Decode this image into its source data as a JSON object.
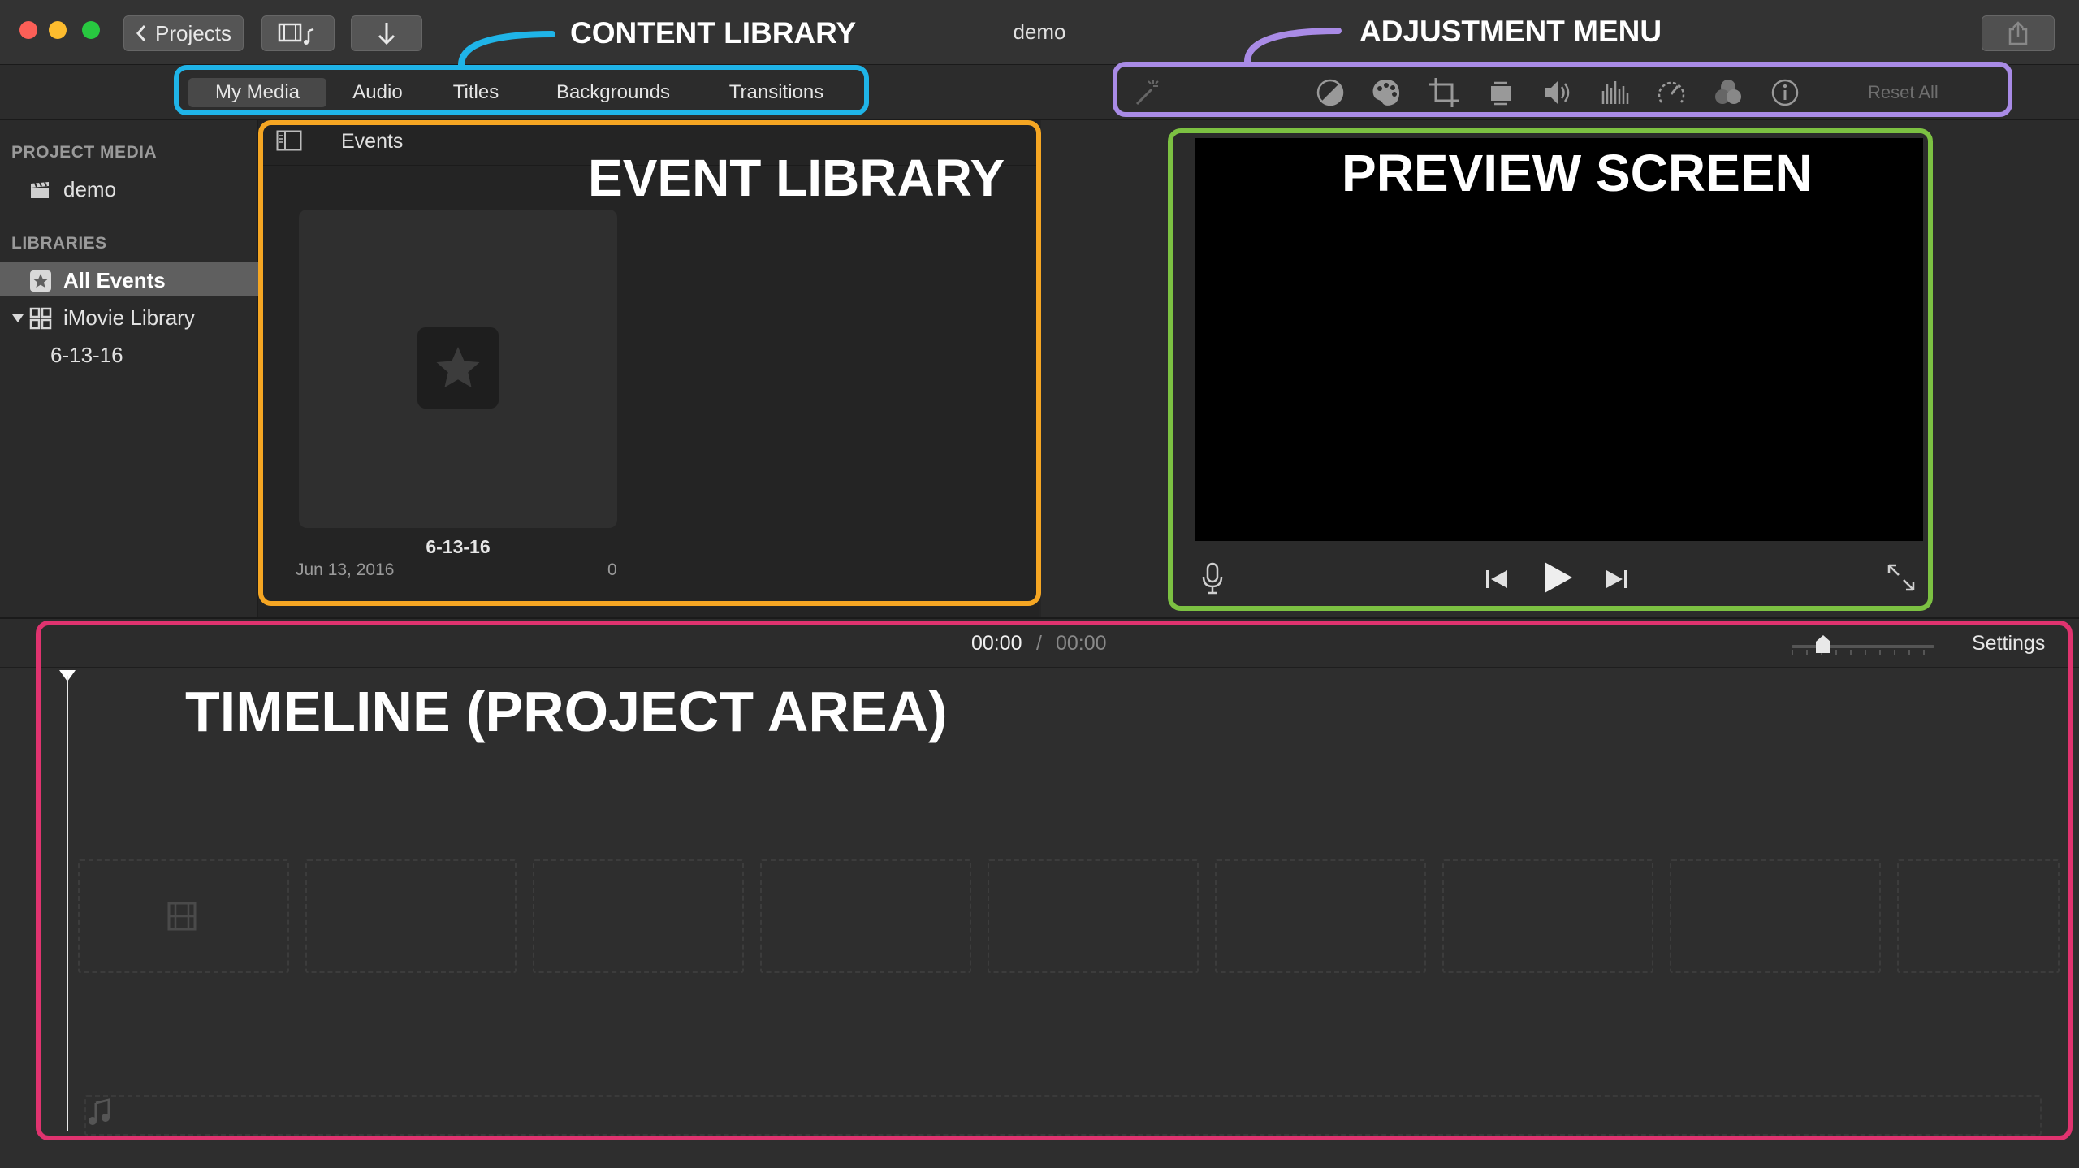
{
  "window": {
    "title": "demo"
  },
  "toolbar": {
    "projects_label": "Projects",
    "share_icon": "share-icon"
  },
  "tabs": [
    "My Media",
    "Audio",
    "Titles",
    "Backgrounds",
    "Transitions"
  ],
  "active_tab": "My Media",
  "adjustments": {
    "icons": [
      "magic-wand-icon",
      "color-balance-icon",
      "color-correction-icon",
      "crop-icon",
      "stabilization-icon",
      "volume-icon",
      "noise-reduction-icon",
      "speed-icon",
      "clip-filter-icon",
      "info-icon"
    ],
    "reset_label": "Reset All"
  },
  "sidebar": {
    "project_media_heading": "PROJECT MEDIA",
    "project_name": "demo",
    "libraries_heading": "LIBRARIES",
    "all_events_label": "All Events",
    "library_label": "iMovie Library",
    "event_label": "6-13-16"
  },
  "browser": {
    "header_label": "Events",
    "event": {
      "name": "6-13-16",
      "date": "Jun 13, 2016",
      "count": "0"
    }
  },
  "timeline": {
    "current_time": "00:00",
    "separator": "/",
    "total_time": "00:00",
    "settings_label": "Settings"
  },
  "annotations": {
    "content_library": "CONTENT LIBRARY",
    "adjustment_menu": "ADJUSTMENT MENU",
    "event_library": "EVENT LIBRARY",
    "preview_screen": "PREVIEW SCREEN",
    "timeline": "TIMELINE (PROJECT AREA)"
  },
  "colors": {
    "content_library": "#1fb4e8",
    "adjustment_menu": "#a98be6",
    "event_library": "#f5a623",
    "preview_screen": "#7cc142",
    "timeline": "#e0336f"
  }
}
